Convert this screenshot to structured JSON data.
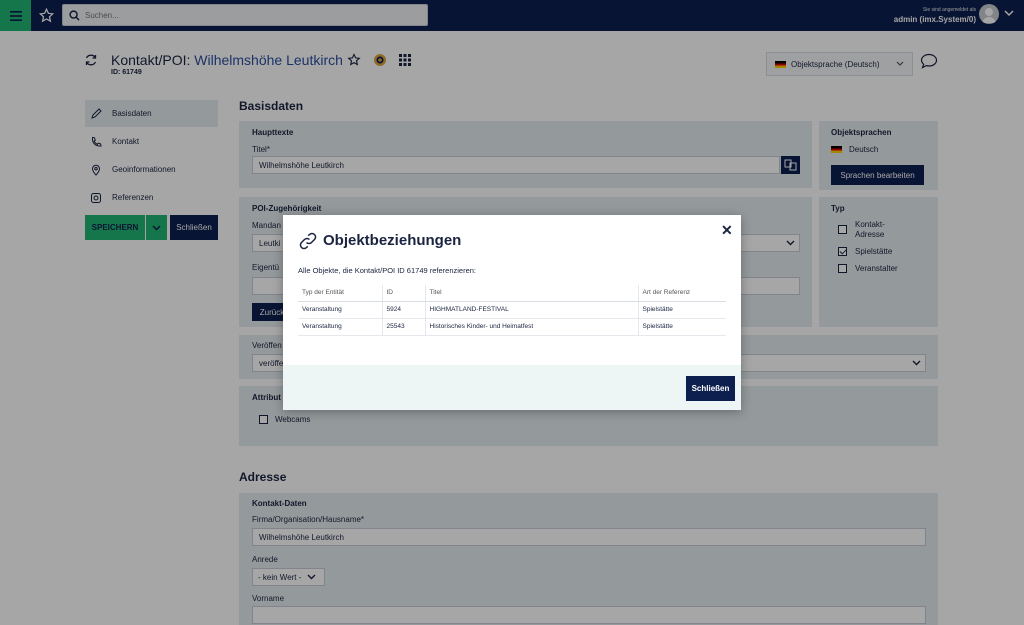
{
  "topbar": {
    "search_placeholder": "Suchen...",
    "login_note": "Sie sind angemeldet als",
    "user": "admin (imx.System/0)"
  },
  "header": {
    "title_prefix": "Kontakt/POI:",
    "title_name": "Wilhelmshöhe Leutkirch",
    "id_label": "ID: 61749",
    "language_select": "Objektsprache (Deutsch)"
  },
  "sidebar": {
    "items": [
      {
        "label": "Basisdaten",
        "icon": "pencil-icon"
      },
      {
        "label": "Kontakt",
        "icon": "phone-icon"
      },
      {
        "label": "Geoinformationen",
        "icon": "map-pin-icon"
      },
      {
        "label": "Referenzen",
        "icon": "references-icon"
      }
    ],
    "save_label": "SPEICHERN",
    "close_label": "Schließen"
  },
  "basisdaten": {
    "heading": "Basisdaten",
    "haupttexte_label": "Haupttexte",
    "titel_label": "Titel*",
    "titel_value": "Wilhelmshöhe Leutkirch",
    "poi_label": "POI-Zugehörigkeit",
    "mandant_label": "Mandan",
    "mandant_value": "Leutki",
    "eigentuemer_label": "Eigentü",
    "back_btn": "Zurück",
    "veroeff_label": "Veröffen",
    "veroeff_value": "veröffe",
    "attribute_label": "Attribut",
    "webcams_label": "Webcams"
  },
  "objektsprachen": {
    "heading": "Objektsprachen",
    "language": "Deutsch",
    "edit_btn": "Sprachen bearbeiten"
  },
  "typ": {
    "heading": "Typ",
    "options": [
      {
        "label": "Kontakt-\nAdresse",
        "checked": false
      },
      {
        "label": "Spielstätte",
        "checked": true
      },
      {
        "label": "Veranstalter",
        "checked": false
      }
    ]
  },
  "adresse": {
    "heading": "Adresse",
    "kontakt_label": "Kontakt-Daten",
    "firma_label": "Firma/Organisation/Hausname*",
    "firma_value": "Wilhelmshöhe Leutkirch",
    "anrede_label": "Anrede",
    "anrede_value": "- kein Wert -",
    "vorname_label": "Vorname"
  },
  "modal": {
    "title": "Objektbeziehungen",
    "description": "Alle Objekte, die Kontakt/POI ID 61749 referenzieren:",
    "columns": [
      "Typ der Entität",
      "ID",
      "Titel",
      "Art der Referenz"
    ],
    "rows": [
      [
        "Veranstaltung",
        "5924",
        "HIGHMATLAND-FESTIVAL",
        "Spielstätte"
      ],
      [
        "Veranstaltung",
        "25543",
        "Historisches Kinder- und Heimatfest",
        "Spielstätte"
      ]
    ],
    "close_btn": "Schließen"
  },
  "colors": {
    "navy": "#0d1f4f",
    "green": "#22b573",
    "panel": "#e3ecee"
  }
}
